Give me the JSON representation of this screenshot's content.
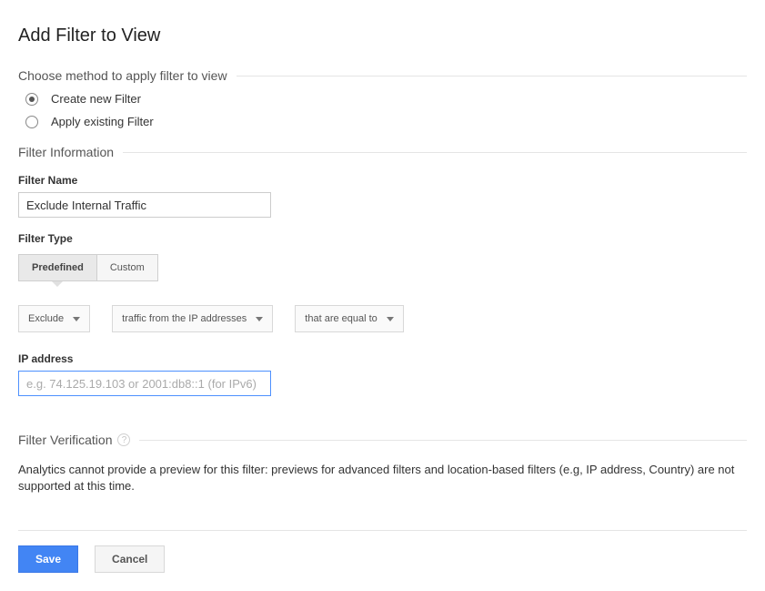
{
  "page": {
    "title": "Add Filter to View"
  },
  "method": {
    "heading": "Choose method to apply filter to view",
    "options": {
      "create": "Create new Filter",
      "existing": "Apply existing Filter"
    },
    "selected": "create"
  },
  "filter_info": {
    "heading": "Filter Information",
    "name_label": "Filter Name",
    "name_value": "Exclude Internal Traffic",
    "type_label": "Filter Type",
    "type_tabs": {
      "predefined": "Predefined",
      "custom": "Custom"
    },
    "type_selected": "predefined",
    "dropdowns": {
      "action": "Exclude",
      "source": "traffic from the IP addresses",
      "match": "that are equal to"
    },
    "ip_label": "IP address",
    "ip_placeholder": "e.g. 74.125.19.103 or 2001:db8::1 (for IPv6)",
    "ip_value": ""
  },
  "verification": {
    "heading": "Filter Verification",
    "message": "Analytics cannot provide a preview for this filter: previews for advanced filters and location-based filters (e.g, IP address, Country) are not supported at this time."
  },
  "buttons": {
    "save": "Save",
    "cancel": "Cancel"
  }
}
